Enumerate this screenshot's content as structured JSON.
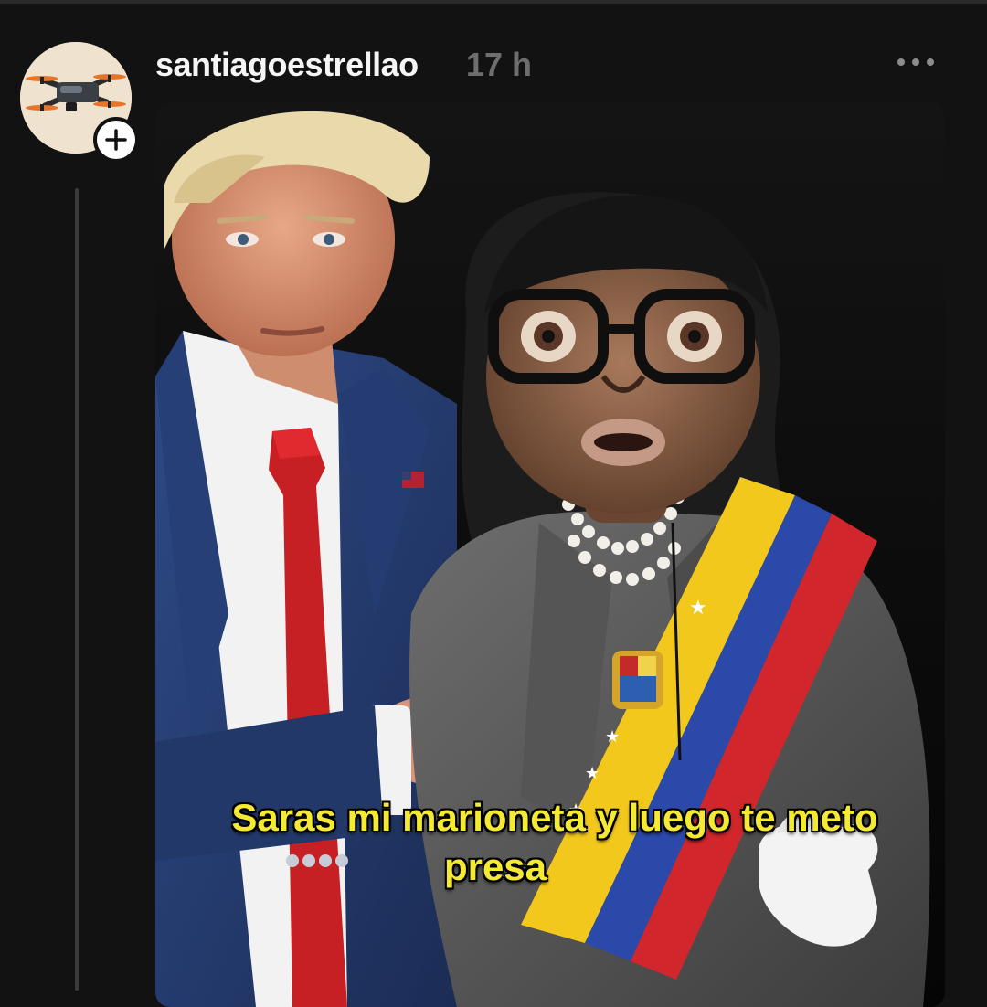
{
  "post": {
    "username": "santiagoestrellao",
    "timestamp": "17 h",
    "media_caption": {
      "line1": "Saras mi marioneta y  luego te meto",
      "line2": "presa"
    }
  },
  "icons": {
    "avatar": "drone-avatar-icon",
    "follow": "plus-icon",
    "more": "more-dots-icon"
  },
  "colors": {
    "background": "#121212",
    "caption": "#f4ea34",
    "timestamp": "#6e6e6e"
  }
}
